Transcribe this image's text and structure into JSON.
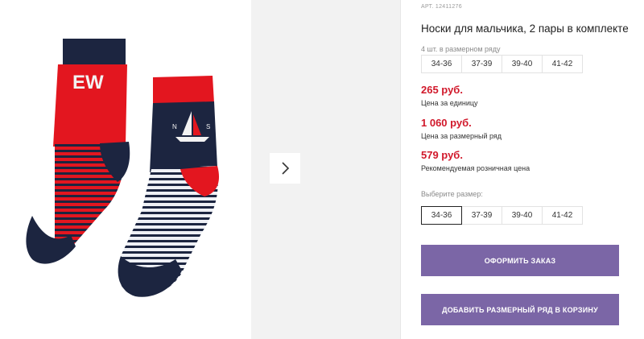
{
  "product": {
    "sku_label": "АРТ.",
    "sku": "12411276",
    "title": "Носки для мальчика, 2 пары в комплекте",
    "pack_note": "4 шт. в размерном ряду",
    "pack_sizes": [
      "34-36",
      "37-39",
      "39-40",
      "41-42"
    ]
  },
  "prices": {
    "unit_price": "265 руб.",
    "unit_note": "Цена за единицу",
    "row_price": "1 060 руб.",
    "row_note": "Цена за размерный ряд",
    "retail_price": "579 руб.",
    "retail_note": "Рекомендуемая розничная цена",
    "price_color": "#d1192b"
  },
  "size_select": {
    "label": "Выберите размер:",
    "options": [
      "34-36",
      "37-39",
      "39-40",
      "41-42"
    ],
    "selected": "34-36"
  },
  "actions": {
    "order_label": "ОФОРМИТЬ ЗАКАЗ",
    "cart_label": "ДОБАВИТЬ РАЗМЕРНЫЙ РЯД В КОРЗИНУ",
    "button_color": "#7b66a6"
  },
  "gallery": {
    "sock_left_text": "EW",
    "sock_right_left_letter": "N",
    "sock_right_right_letter": "S",
    "next_icon": "chevron-right-icon"
  }
}
